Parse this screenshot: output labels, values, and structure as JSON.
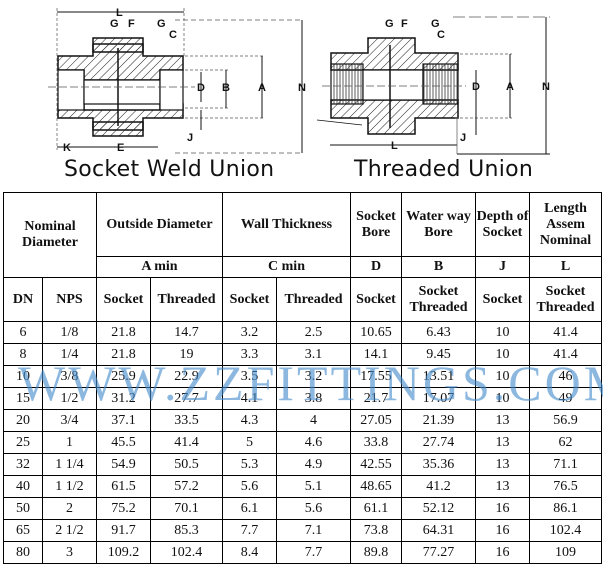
{
  "diagrams": {
    "socket_weld": {
      "caption": "Socket Weld Union",
      "labels": {
        "L": "L",
        "G1": "G",
        "F": "F",
        "G2": "G",
        "C": "C",
        "D": "D",
        "B": "B",
        "A": "A",
        "N": "N",
        "J": "J",
        "K": "K",
        "E": "E"
      }
    },
    "threaded": {
      "caption": "Threaded Union",
      "labels": {
        "G1": "G",
        "F": "F",
        "G2": "G",
        "C": "C",
        "D": "D",
        "A": "A",
        "N": "N",
        "J": "J",
        "L": "L"
      }
    }
  },
  "watermark": "WWW.ZZFITTINGS.COM",
  "table": {
    "group_headers": {
      "nominal_diameter": "Nominal Diameter",
      "outside_diameter": "Outside Diameter",
      "wall_thickness": "Wall Thickness",
      "socket_bore": "Socket Bore",
      "water_way_bore": "Water way Bore",
      "depth_of_socket": "Depth of Socket",
      "length_assem_nominal": "Length Assem Nominal"
    },
    "symbols": {
      "a_min": "A min",
      "c_min": "C min",
      "d": "D",
      "b": "B",
      "j": "J",
      "l": "L"
    },
    "sub_headers": [
      "DN",
      "NPS",
      "Socket",
      "Threaded",
      "Socket",
      "Threaded",
      "Socket",
      "Socket Threaded",
      "Socket",
      "Socket Threaded"
    ],
    "rows": [
      [
        "6",
        "1/8",
        "21.8",
        "14.7",
        "3.2",
        "2.5",
        "10.65",
        "6.43",
        "10",
        "41.4"
      ],
      [
        "8",
        "1/4",
        "21.8",
        "19",
        "3.3",
        "3.1",
        "14.1",
        "9.45",
        "10",
        "41.4"
      ],
      [
        "10",
        "3/8",
        "25.9",
        "22.9",
        "3.5",
        "3.2",
        "17.55",
        "13.51",
        "10",
        "46"
      ],
      [
        "15",
        "1/2",
        "31.2",
        "27.7",
        "4.1",
        "3.8",
        "21.7",
        "17.07",
        "10",
        "49"
      ],
      [
        "20",
        "3/4",
        "37.1",
        "33.5",
        "4.3",
        "4",
        "27.05",
        "21.39",
        "13",
        "56.9"
      ],
      [
        "25",
        "1",
        "45.5",
        "41.4",
        "5",
        "4.6",
        "33.8",
        "27.74",
        "13",
        "62"
      ],
      [
        "32",
        "1 1/4",
        "54.9",
        "50.5",
        "5.3",
        "4.9",
        "42.55",
        "35.36",
        "13",
        "71.1"
      ],
      [
        "40",
        "1 1/2",
        "61.5",
        "57.2",
        "5.6",
        "5.1",
        "48.65",
        "41.2",
        "13",
        "76.5"
      ],
      [
        "50",
        "2",
        "75.2",
        "70.1",
        "6.1",
        "5.6",
        "61.1",
        "52.12",
        "16",
        "86.1"
      ],
      [
        "65",
        "2 1/2",
        "91.7",
        "85.3",
        "7.7",
        "7.1",
        "73.8",
        "64.31",
        "16",
        "102.4"
      ],
      [
        "80",
        "3",
        "109.2",
        "102.4",
        "8.4",
        "7.7",
        "89.8",
        "77.27",
        "16",
        "109"
      ]
    ]
  }
}
